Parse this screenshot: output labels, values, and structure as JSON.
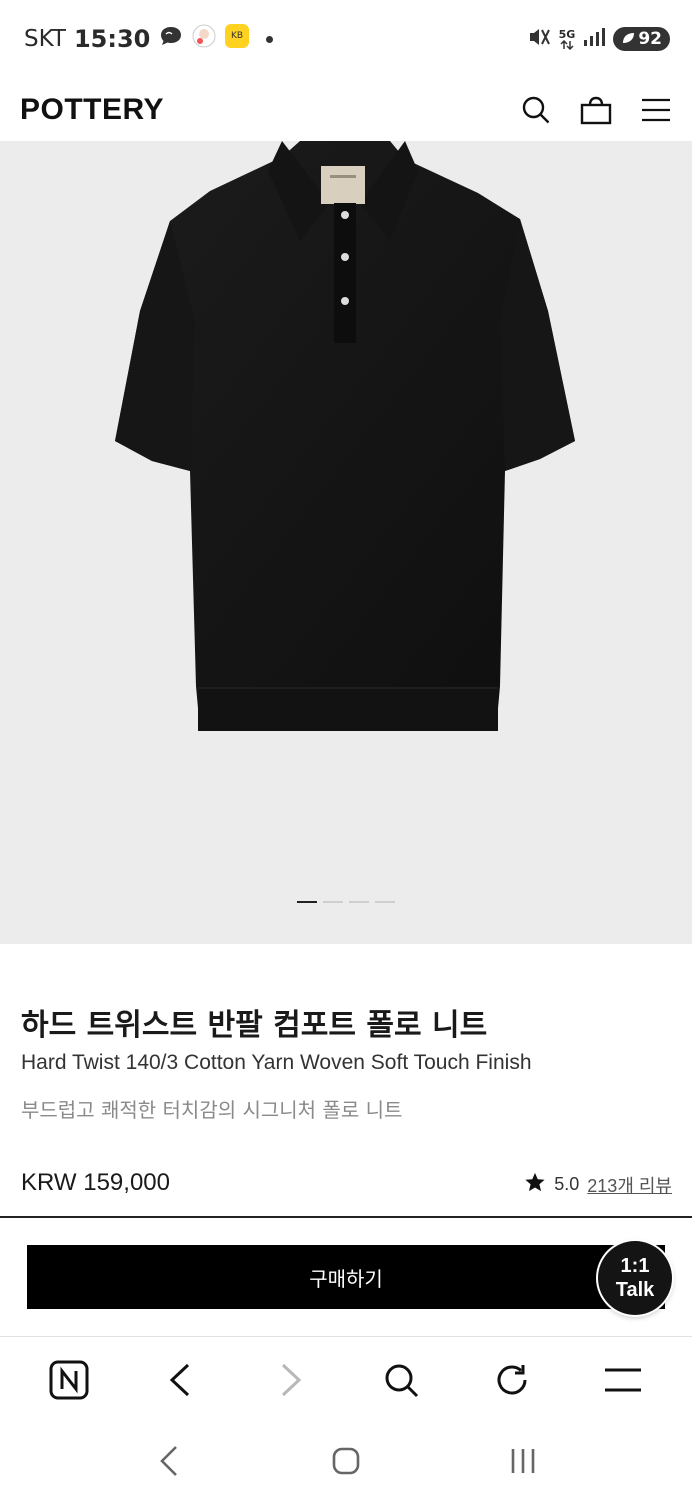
{
  "status_bar": {
    "carrier": "SKT",
    "time": "15:30",
    "network": "5G",
    "battery": "92"
  },
  "header": {
    "logo": "POTTERY",
    "icons": [
      "search-icon",
      "shopping-bag-icon",
      "menu-icon"
    ]
  },
  "gallery": {
    "total_slides": 4,
    "active_slide": 1,
    "background": "#ececec"
  },
  "product": {
    "title_ko": "하드 트위스트 반팔 컴포트 폴로 니트",
    "title_en": "Hard Twist 140/3 Cotton Yarn Woven Soft Touch Finish",
    "description": "부드럽고 쾌적한 터치감의 시그니처 폴로 니트",
    "price": "KRW 159,000",
    "rating": "5.0",
    "reviews": "213개 리뷰"
  },
  "actions": {
    "buy_label": "구매하기",
    "talk_line1": "1:1",
    "talk_line2": "Talk"
  },
  "browser_bar": {
    "icons": [
      "naver-home-icon",
      "back-icon",
      "forward-icon",
      "search-icon",
      "refresh-icon",
      "menu-icon"
    ]
  },
  "nav_bar": {
    "icons": [
      "nav-back-icon",
      "nav-home-icon",
      "nav-recents-icon"
    ]
  },
  "colors": {
    "accent": "#000000",
    "muted_text": "#8a8a8a"
  }
}
